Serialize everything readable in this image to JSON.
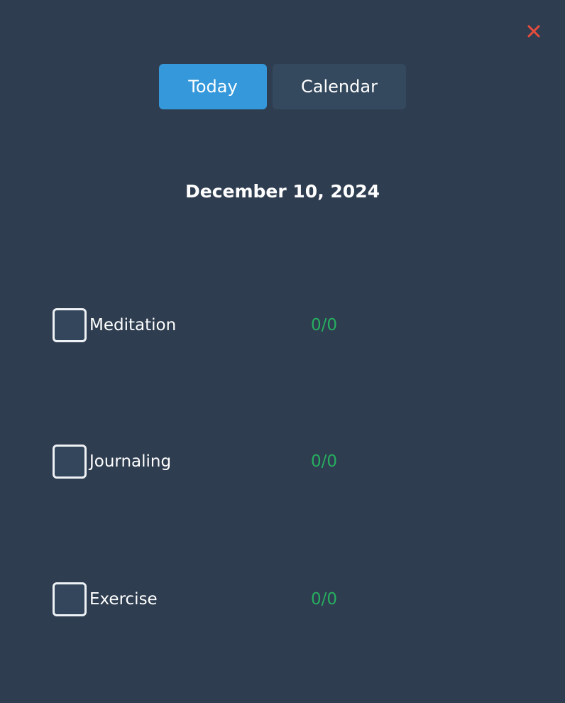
{
  "close": {
    "icon": "close-icon",
    "glyph": "✕",
    "color": "#e74c3c"
  },
  "tabs": [
    {
      "label": "Today",
      "active": true,
      "color": "#3498db"
    },
    {
      "label": "Calendar",
      "active": false,
      "color": "#34495e"
    }
  ],
  "date": {
    "title": "December 10, 2024"
  },
  "habits": [
    {
      "label": "Meditation",
      "progress": "0/0",
      "checked": false
    },
    {
      "label": "Journaling",
      "progress": "0/0",
      "checked": false
    },
    {
      "label": "Exercise",
      "progress": "0/0",
      "checked": false
    }
  ],
  "colors": {
    "background": "#2e3d50",
    "progress": "#27ae60",
    "text": "#ffffff"
  }
}
